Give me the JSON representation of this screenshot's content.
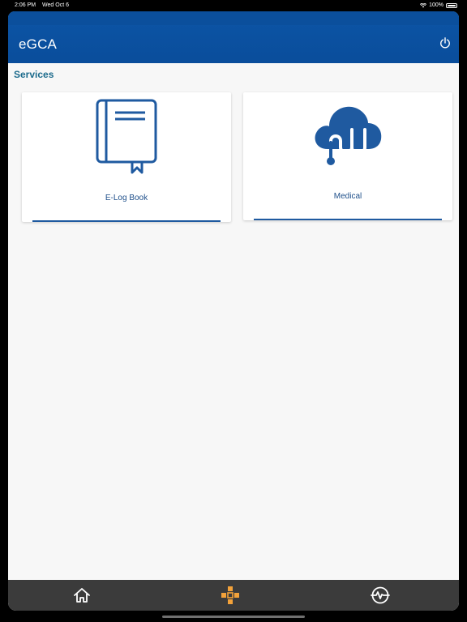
{
  "status_bar": {
    "time": "2:06 PM",
    "date": "Wed Oct 6",
    "battery": "100%",
    "icons": [
      "wifi-icon",
      "battery-icon"
    ]
  },
  "header": {
    "title": "eGCA",
    "power_icon": "power-icon"
  },
  "section": {
    "title": "Services"
  },
  "services": [
    {
      "label": "E-Log Book",
      "icon": "book-icon"
    },
    {
      "label": "Medical",
      "icon": "cloud-stethoscope-icon"
    }
  ],
  "tabbar": {
    "items": [
      {
        "icon": "home-icon"
      },
      {
        "icon": "services-icon"
      },
      {
        "icon": "activity-history-icon"
      }
    ]
  },
  "colors": {
    "header": "#0c55a6",
    "accent": "#1f5aa0",
    "section_title": "#1c6b8c",
    "tab_active": "#f3a23a",
    "tabbar": "#3b3b3b"
  }
}
